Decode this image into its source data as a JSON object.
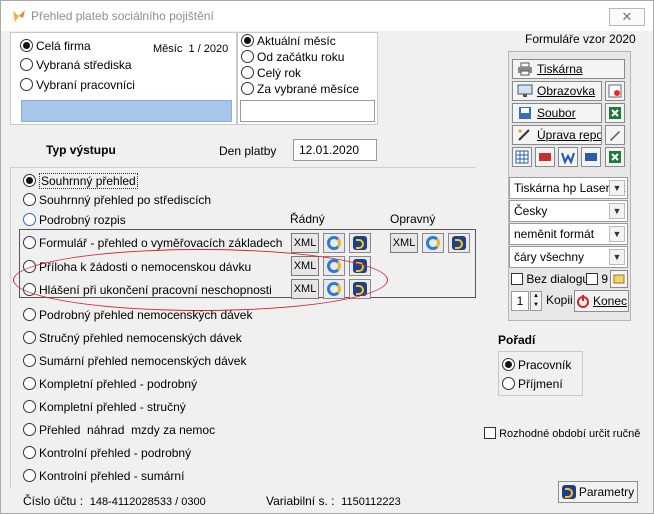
{
  "window": {
    "title": "Přehled plateb sociálního pojištění",
    "close": "✕"
  },
  "scope": {
    "options": [
      "Celá firma",
      "Vybraná střediska",
      "Vybraní pracovníci"
    ],
    "selected": 0
  },
  "month": {
    "label": "Měsíc",
    "value": "1 / 2020"
  },
  "period": {
    "options": [
      "Aktuální měsíc",
      "Od začátku roku",
      "Celý rok",
      "Za vybrané měsíce"
    ],
    "selected": 0
  },
  "typ_label": "Typ výstupu",
  "den_platby": {
    "label": "Den platby",
    "value": "12.01.2020"
  },
  "columns": {
    "radny": "Řádný",
    "opravny": "Opravný"
  },
  "xml_label": "XML",
  "outputs": [
    "Souhrnný přehled",
    "Souhrnný přehled po střediscích",
    "Podrobný rozpis",
    "Formulář - přehled o vyměřovacích základech",
    "Příloha k žádosti o nemocenskou dávku",
    "Hlášení při ukončení pracovní neschopnosti",
    "Podrobný přehled nemocenských dávek",
    "Stručný přehled nemocenských dávek",
    "Sumární přehled nemocenských dávek",
    "Kompletní přehled - podrobný",
    "Kompletní přehled - stručný",
    "Přehled  náhrad  mzdy za nemoc",
    "Kontrolní přehled - podrobný",
    "Kontrolní přehled - sumární"
  ],
  "output_selected": 0,
  "footer": {
    "ucet_label": "Číslo účtu :",
    "ucet_value": "148-4112028533 / 0300",
    "vs_label": "Variabilní s. :",
    "vs_value": "1150112223"
  },
  "side": {
    "form_title": "Formuláře vzor 2020",
    "tiskarna": "Tiskárna",
    "obrazovka": "Obrazovka",
    "soubor": "Soubor",
    "uprava": "Úprava reportu",
    "printer_select": "Tiskárna hp LaserJet",
    "lang_select": "Česky",
    "format_select": "neměnit formát",
    "lines_select": "čáry všechny",
    "bez_dialogu": "Bez dialogu",
    "copies_count_label": "9",
    "copies_value": "1",
    "kopii": "Kopii",
    "konec": "Konec",
    "poradi_title": "Pořadí",
    "poradi_options": [
      "Pracovník",
      "Příjmení"
    ],
    "poradi_selected": 0,
    "rozhodne": "Rozhodné období určit ručně",
    "parametry": "Parametry"
  }
}
